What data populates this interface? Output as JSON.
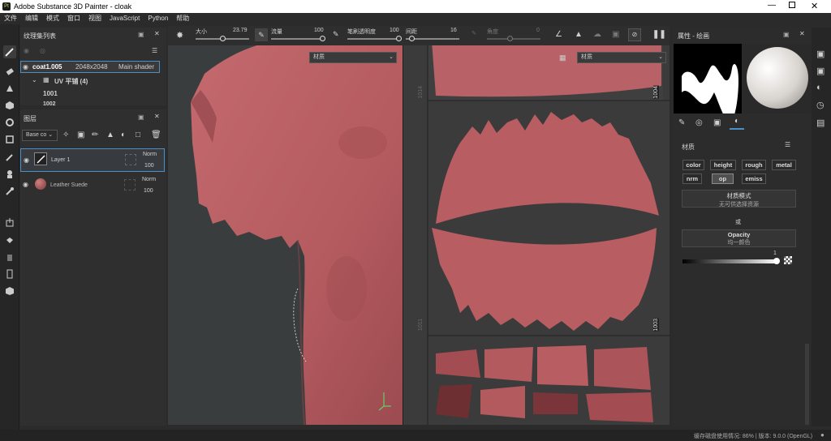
{
  "window": {
    "title": "Adobe Substance 3D Painter - cloak"
  },
  "menu": [
    "文件",
    "编辑",
    "模式",
    "窗口",
    "视图",
    "JavaScript",
    "Python",
    "帮助"
  ],
  "textureset": {
    "title": "纹理集列表",
    "item_name": "coat1.005",
    "item_res": "2048x2048",
    "item_shader": "Main shader",
    "uv_label": "UV 平铺 (4)",
    "uv_rows": [
      "1001",
      "1002"
    ]
  },
  "layers": {
    "title": "图层",
    "channel_select": "Base co",
    "items": [
      {
        "name": "Layer 1",
        "blend": "Norm",
        "opacity": "100"
      },
      {
        "name": "Leather Suede",
        "blend": "Norm",
        "opacity": "100"
      }
    ]
  },
  "toolbar": {
    "size_label": "大小",
    "size_value": "23.79",
    "flow_label": "流量",
    "flow_value": "100",
    "stroke_opacity_label": "笔刷透明度",
    "stroke_opacity_value": "100",
    "spacing_label": "间距",
    "spacing_value": "16",
    "angle_label": "角度",
    "angle_value": "0"
  },
  "viewport": {
    "material_3d": "材质",
    "material_2d": "材质",
    "udim_labels": [
      "1004",
      "1014",
      "1011",
      "1003"
    ]
  },
  "properties": {
    "title": "属性 - 绘画",
    "material_section": "材质",
    "channels": [
      "color",
      "height",
      "rough",
      "metal",
      "nrm",
      "op",
      "emiss"
    ],
    "mode_button_label": "材质模式",
    "mode_button_sub": "无可供选择资源",
    "or_label": "或",
    "opacity_label": "Opacity",
    "opacity_sub": "均一颜色",
    "opacity_value": "1"
  },
  "status": {
    "text": "缓存磁盘使用情况: 86% | 版本: 9.0.0 (OpenGL)"
  },
  "colors": {
    "accent": "#4a90c8",
    "cloth": "#b85a5e",
    "bg": "#2b2b2b"
  }
}
